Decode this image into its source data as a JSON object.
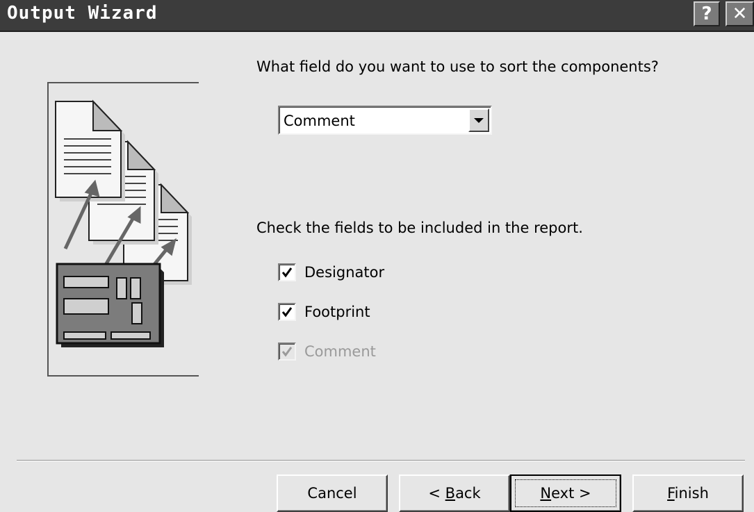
{
  "window": {
    "title": "Output Wizard",
    "help_glyph": "?",
    "close_glyph": "✕"
  },
  "sort": {
    "prompt": "What field do you want to use to sort the components?",
    "selected": "Comment"
  },
  "fields": {
    "prompt": "Check the fields to be included in the report.",
    "items": [
      {
        "label": "Designator",
        "checked": true,
        "enabled": true
      },
      {
        "label": "Footprint",
        "checked": true,
        "enabled": true
      },
      {
        "label": "Comment",
        "checked": true,
        "enabled": false
      }
    ]
  },
  "buttons": {
    "cancel": "Cancel",
    "back_prefix": "< ",
    "back_mnemonic": "B",
    "back_rest": "ack",
    "next_mnemonic": "N",
    "next_rest": "ext >",
    "finish_mnemonic": "F",
    "finish_rest": "inish"
  },
  "icons": {
    "help": "help-icon",
    "close": "close-icon",
    "dropdown": "chevron-down-icon",
    "check": "checkmark-icon",
    "illustration": "documents-to-circuit-board-illustration"
  },
  "colors": {
    "dialog_bg": "#e6e6e6",
    "titlebar_bg": "#3c3c3c",
    "disabled_text": "#9a9a9a"
  }
}
